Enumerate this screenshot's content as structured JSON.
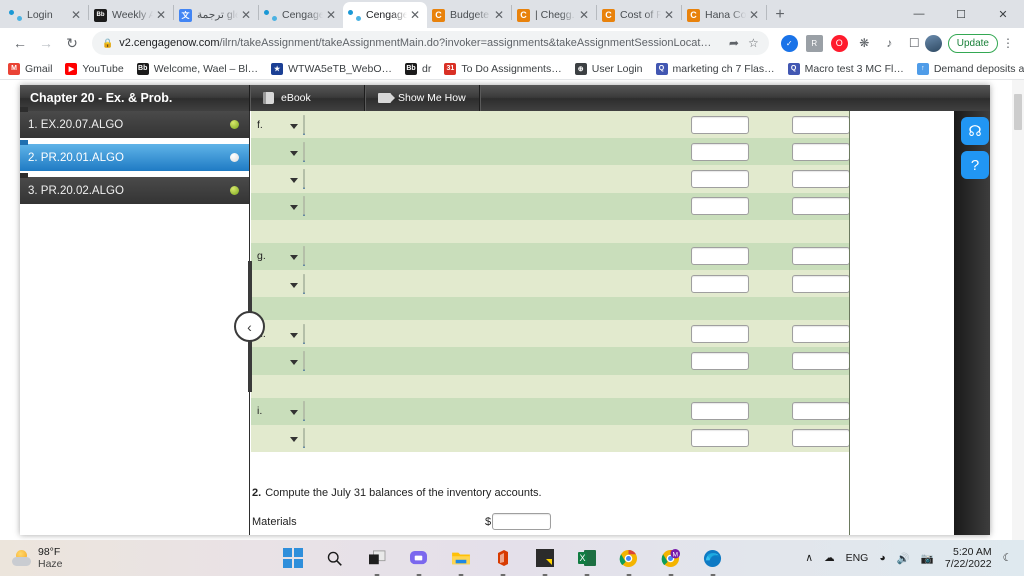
{
  "browser": {
    "tabs": [
      {
        "title": "Login",
        "favicon": "cengage-icon",
        "active": false,
        "sep_after": true
      },
      {
        "title": "Weekly A",
        "favicon": "blackboard-icon",
        "active": false,
        "sep_after": true
      },
      {
        "title": "ترجمة gle",
        "favicon": "google-translate-icon",
        "active": false,
        "sep_after": true
      },
      {
        "title": "Cengage",
        "favicon": "cengage-icon",
        "active": false,
        "sep_after": false
      },
      {
        "title": "Cengage",
        "favicon": "cengage-icon",
        "active": true,
        "sep_after": false
      },
      {
        "title": "Budgete",
        "favicon": "chegg-icon",
        "active": false,
        "sep_after": true
      },
      {
        "title": "| Chegg.",
        "favicon": "chegg-icon",
        "active": false,
        "sep_after": true
      },
      {
        "title": "Cost of P",
        "favicon": "chegg-icon",
        "active": false,
        "sep_after": true
      },
      {
        "title": "Hana  Co",
        "favicon": "chegg-icon",
        "active": false,
        "sep_after": true
      }
    ],
    "new_tab_label": "+",
    "window_controls": {
      "minimize": "—",
      "maximize": "☐",
      "close": "✕"
    },
    "nav": {
      "back": "←",
      "forward": "→",
      "reload": "↻"
    },
    "address": {
      "lock_icon": "lock-icon",
      "domain": "v2.cengagenow.com",
      "path": "/ilrn/takeAssignment/takeAssignmentMain.do?invoker=assignments&takeAssignmentSessionLocat…",
      "share_icon": "share-icon",
      "bookmark_icon": "star-icon"
    },
    "extensions": [
      {
        "name": "sync-badge-icon",
        "glyph": "✓"
      },
      {
        "name": "extension-gray-icon",
        "glyph": "R"
      },
      {
        "name": "opera-vpn-icon",
        "glyph": "O"
      },
      {
        "name": "puzzle-extensions-icon",
        "glyph": "✷"
      },
      {
        "name": "reading-list-icon",
        "glyph": "♫"
      },
      {
        "name": "sidebar-icon",
        "glyph": "□"
      }
    ],
    "profile_avatar": "avatar",
    "update_button": "Update",
    "menu_icon": "kebab-menu-icon",
    "bookmarks": [
      {
        "label": "Gmail",
        "icon": "gmail-icon",
        "color": "#ea4335",
        "glyph": "M"
      },
      {
        "label": "YouTube",
        "icon": "youtube-icon",
        "color": "#ff0000",
        "glyph": "▶"
      },
      {
        "label": "Welcome, Wael – Bl…",
        "icon": "blackboard-icon",
        "color": "#1b1b1b",
        "glyph": "Bb"
      },
      {
        "label": "WTWA5eTB_WebO…",
        "icon": "star-blue-icon",
        "color": "#1b3f94",
        "glyph": "★"
      },
      {
        "label": "dr",
        "icon": "blackboard-icon",
        "color": "#1b1b1b",
        "glyph": "Bb"
      },
      {
        "label": "To Do Assignments…",
        "icon": "calendar-icon",
        "color": "#d93025",
        "glyph": "31"
      },
      {
        "label": "User Login",
        "icon": "globe-icon",
        "color": "#3c4043",
        "glyph": "⊕"
      },
      {
        "label": "marketing ch 7 Flas…",
        "icon": "quizlet-icon",
        "color": "#4257b2",
        "glyph": "Q"
      },
      {
        "label": "Macro test 3 MC Fl…",
        "icon": "quizlet-icon",
        "color": "#4257b2",
        "glyph": "Q"
      },
      {
        "label": "Demand deposits a…",
        "icon": "arrow-up-circle-icon",
        "color": "#4f9ce8",
        "glyph": "↑"
      }
    ]
  },
  "app": {
    "header": {
      "title": "Chapter 20 - Ex. & Prob.",
      "ebook_button": "eBook",
      "show_me_how_button": "Show Me How"
    },
    "sidebar": {
      "items": [
        {
          "label": "1. EX.20.07.ALGO",
          "status": "green",
          "selected": false
        },
        {
          "label": "2. PR.20.01.ALGO",
          "status": "white",
          "selected": true
        },
        {
          "label": "3. PR.20.02.ALGO",
          "status": "green",
          "selected": false
        }
      ],
      "collapse_icon": "chevron-left-icon"
    },
    "question_table": {
      "rows": [
        {
          "label": "f.",
          "type": "entry",
          "shade": "light",
          "select": true,
          "inputs": 2
        },
        {
          "label": "",
          "type": "entry",
          "shade": "dark",
          "select": true,
          "inputs": 2
        },
        {
          "label": "",
          "type": "entry",
          "shade": "light",
          "select": true,
          "inputs": 2
        },
        {
          "label": "",
          "type": "entry",
          "shade": "dark",
          "select": true,
          "inputs": 2
        },
        {
          "label": "",
          "type": "spacer",
          "shade": "light",
          "select": false,
          "inputs": 0
        },
        {
          "label": "g.",
          "type": "entry",
          "shade": "dark",
          "select": true,
          "inputs": 2
        },
        {
          "label": "",
          "type": "entry",
          "shade": "light",
          "select": true,
          "inputs": 2
        },
        {
          "label": "",
          "type": "spacer",
          "shade": "dark",
          "select": false,
          "inputs": 0
        },
        {
          "label": "h.",
          "type": "entry",
          "shade": "light",
          "select": true,
          "inputs": 2
        },
        {
          "label": "",
          "type": "entry",
          "shade": "dark",
          "select": true,
          "inputs": 2
        },
        {
          "label": "",
          "type": "spacer",
          "shade": "light",
          "select": false,
          "inputs": 0
        },
        {
          "label": "i.",
          "type": "entry",
          "shade": "dark",
          "select": true,
          "inputs": 2
        },
        {
          "label": "",
          "type": "entry",
          "shade": "light",
          "select": true,
          "inputs": 2
        }
      ],
      "select_value": "",
      "input_value": ""
    },
    "section2": {
      "number": "2.",
      "instruction": "Compute the July 31 balances of the inventory accounts.",
      "rows": [
        {
          "label": "Materials",
          "currency": "$",
          "value": ""
        }
      ]
    },
    "right_rail": {
      "support_icon": "headset-icon",
      "help_icon": "question-mark-icon"
    }
  },
  "taskbar": {
    "weather": {
      "temp": "98°F",
      "condition": "Haze",
      "icon": "haze-sun-icon"
    },
    "icons": [
      {
        "name": "start-icon"
      },
      {
        "name": "search-icon"
      },
      {
        "name": "task-view-icon"
      },
      {
        "name": "teams-chat-icon"
      },
      {
        "name": "file-explorer-icon"
      },
      {
        "name": "office-icon"
      },
      {
        "name": "sticky-notes-icon"
      },
      {
        "name": "excel-icon"
      },
      {
        "name": "chrome-icon"
      },
      {
        "name": "chrome-profile-icon"
      },
      {
        "name": "edge-icon"
      }
    ],
    "tray": {
      "chevron": "∧",
      "onedrive_icon": "cloud-icon",
      "language": "ENG",
      "wifi_icon": "wifi-icon",
      "volume_icon": "speaker-icon",
      "camera_icon": "camera-icon",
      "time": "5:20 AM",
      "date": "7/22/2022",
      "notification_icon": "moon-icon"
    }
  }
}
